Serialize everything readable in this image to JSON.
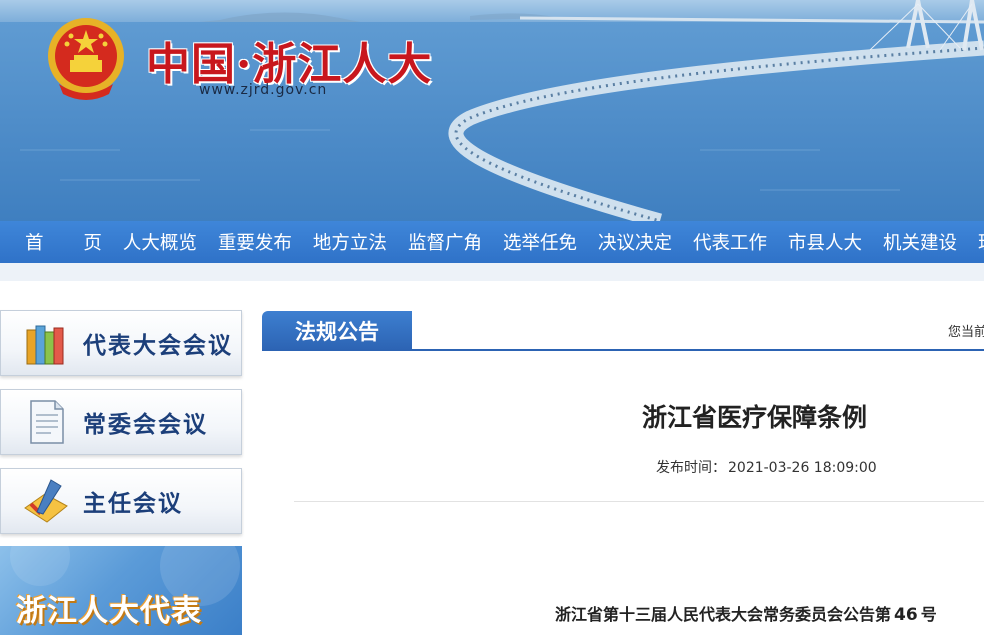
{
  "header": {
    "site_title": "中国·浙江人大",
    "site_url": "www.zjrd.gov.cn"
  },
  "nav": {
    "items": [
      "首 页",
      "人大概览",
      "重要发布",
      "地方立法",
      "监督广角",
      "选举任免",
      "决议决定",
      "代表工作",
      "市县人大",
      "机关建设",
      "理"
    ]
  },
  "sidebar": {
    "items": [
      {
        "label": "代表大会会议",
        "icon": "books-icon"
      },
      {
        "label": "常委会会议",
        "icon": "document-icon"
      },
      {
        "label": "主任会议",
        "icon": "pen-check-icon"
      }
    ],
    "banner_label": "浙江人大代表"
  },
  "section": {
    "title": "法规公告",
    "location_prefix": "您当前"
  },
  "article": {
    "title": "浙江省医疗保障条例",
    "publish_label": "发布时间：",
    "publish_time": "2021-03-26 18:09:00",
    "body_prefix": "浙江省第十三届人民代表大会常务委员会公告第",
    "body_number": "46",
    "body_suffix": "号"
  },
  "colors": {
    "nav_blue": "#2f72c8",
    "title_red": "#c8171d",
    "sidebar_text": "#1c3f7a"
  }
}
